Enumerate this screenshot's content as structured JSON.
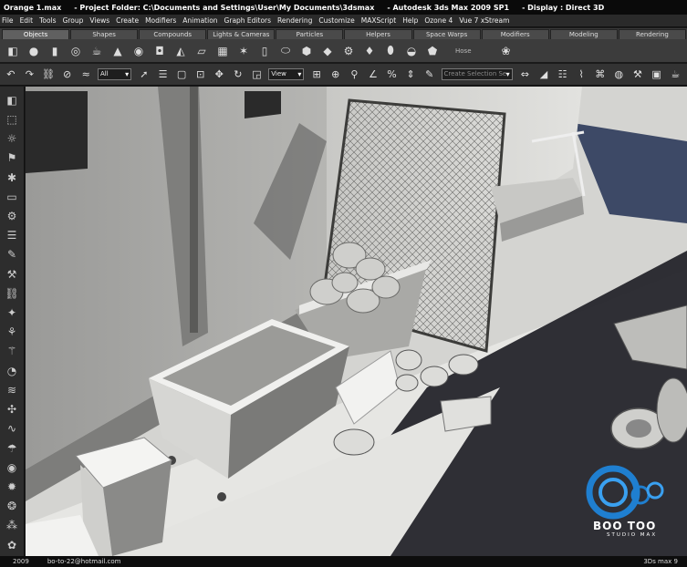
{
  "window": {
    "file": "Orange 1.max",
    "project": "- Project Folder: C:\\Documents and Settings\\User\\My Documents\\3dsmax",
    "app": "- Autodesk 3ds Max  2009 SP1",
    "display": "- Display : Direct 3D"
  },
  "menu": [
    "File",
    "Edit",
    "Tools",
    "Group",
    "Views",
    "Create",
    "Modifiers",
    "Animation",
    "Graph Editors",
    "Rendering",
    "Customize",
    "MAXScript",
    "Help",
    "Ozone 4",
    "Vue 7 xStream"
  ],
  "tabs": [
    "Objects",
    "Shapes",
    "Compounds",
    "Lights & Cameras",
    "Particles",
    "Helpers",
    "Space Warps",
    "Modifiers",
    "Modeling",
    "Rendering"
  ],
  "active_tab": "Objects",
  "shelf": {
    "icons": [
      "box-icon",
      "sphere-icon",
      "cylinder-icon",
      "torus-icon",
      "teapot-icon",
      "cone-icon",
      "geosphere-icon",
      "tube-icon",
      "pyramid-icon",
      "plane-icon",
      "grid-icon",
      "star-icon",
      "cylinder-2-icon",
      "capsule-icon",
      "chamferbox-icon",
      "hedra-icon",
      "gear-icon",
      "spindle-icon",
      "oiltank-icon",
      "cup-icon",
      "extrude-icon"
    ],
    "hose_label": "Hose"
  },
  "toolbar": {
    "filter_value": "All",
    "refcoord_value": "View",
    "named_selection_placeholder": "Create Selection Se"
  },
  "leftbar_icons": [
    "geometry-icon",
    "shapes-icon",
    "lights-icon",
    "cameras-icon",
    "helpers-icon",
    "spacewarps-icon",
    "systems-icon",
    "layers-icon",
    "paint-icon",
    "wrench-icon",
    "link-icon",
    "display-icon",
    "motion-icon",
    "hierarchy-icon",
    "modify-icon",
    "wave-icon",
    "anim-icon",
    "curve-icon",
    "render-icon",
    "material-icon",
    "scene-icon",
    "light-list-icon",
    "particle-icon",
    "ik-icon",
    "snap-icon",
    "percent-icon"
  ],
  "status": {
    "year": "2009",
    "email": "bo-to-22@hotmail.com",
    "version": "3Ds max 9"
  },
  "logo": {
    "brand": "BOO TOO",
    "sub": "STUDIO MAX"
  }
}
